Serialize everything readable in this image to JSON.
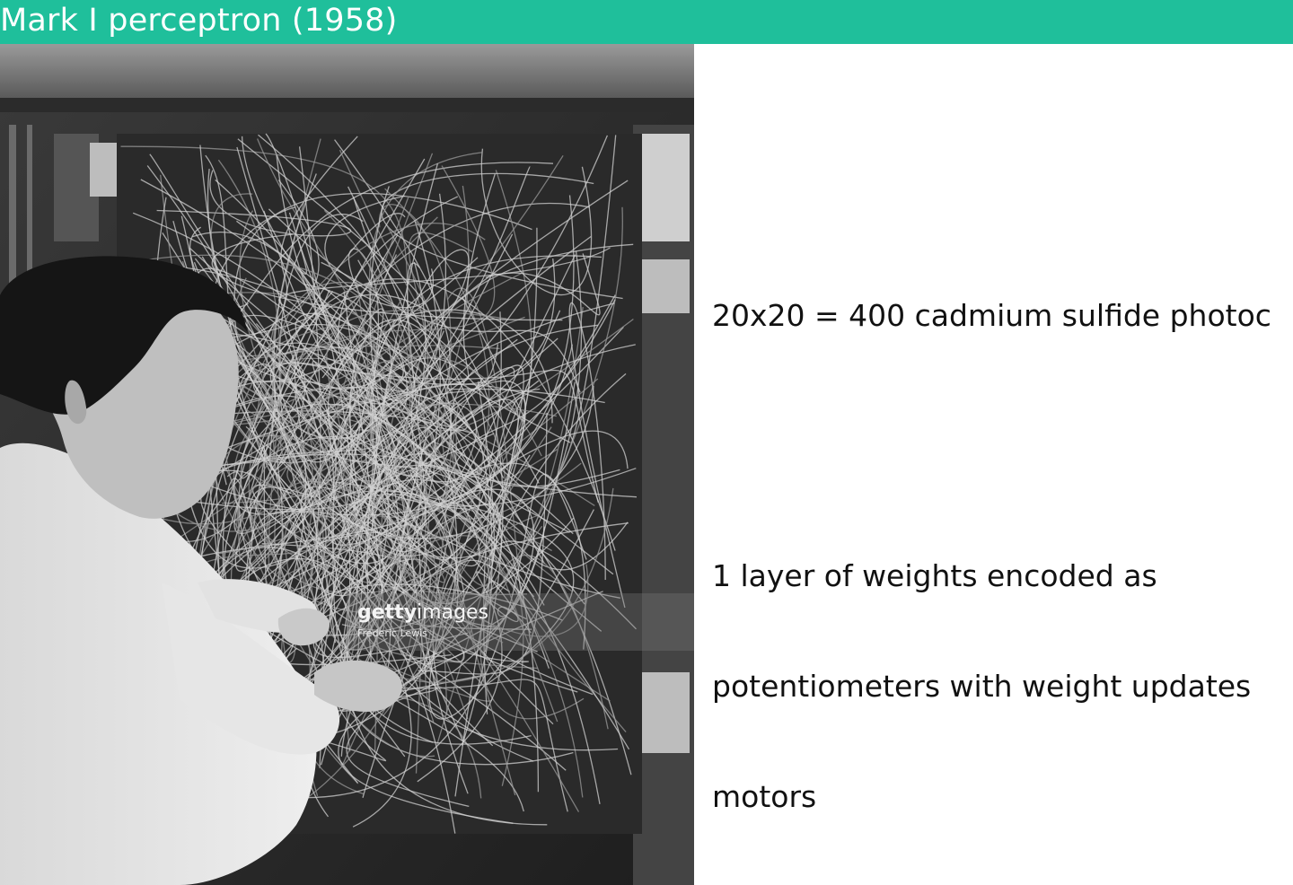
{
  "slide": {
    "title": "Mark I perceptron (1958)",
    "accent_color": "#1fbf9b",
    "photo": {
      "icon": "man-wiring-perceptron-photo",
      "watermark_brand_bold": "getty",
      "watermark_brand_regular": "images",
      "watermark_credit": "Frederic Lewis"
    },
    "bullets": [
      {
        "lines": [
          "20x20 = 400 cadmium sulfide photoc"
        ]
      },
      {
        "lines": [
          "1 layer of weights encoded as",
          "potentiometers with weight updates",
          "motors"
        ]
      }
    ]
  }
}
